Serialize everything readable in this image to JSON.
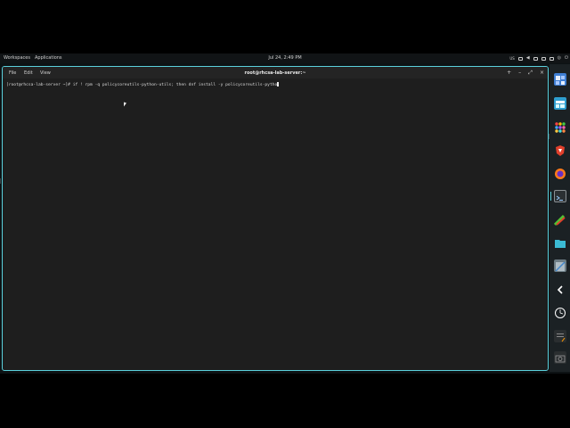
{
  "topbar": {
    "workspaces_label": "Workspaces",
    "applications_label": "Applications",
    "clock": "Jul 24, 2:49 PM",
    "keyboard_layout": "US"
  },
  "window": {
    "menu": {
      "file": "File",
      "edit": "Edit",
      "view": "View"
    },
    "title": "root@rhcsa-lab-server:~",
    "controls": {
      "add": "+",
      "minimize": "–",
      "maximize": "⤢",
      "close": "×"
    }
  },
  "terminal": {
    "prompt": "[root@rhcsa-lab-server ~]# ",
    "command": "if ! rpm -q policycoreutils-python-utils; then dnf install -y policycoreutils-pytho"
  },
  "dock": {
    "icons": [
      "app-grid-icon",
      "files-icon",
      "apps-icon",
      "brave-browser-icon",
      "firefox-icon",
      "terminal-icon",
      "paint-icon",
      "folder-icon",
      "image-viewer-icon",
      "chevron-left-icon",
      "timer-icon",
      "notes-icon",
      "screenshot-icon"
    ],
    "colors": {
      "accent": "#5ad0dc",
      "brave": "#e0402c",
      "firefox": "#ff7a1a",
      "folder": "#3bbbd4",
      "paint": "#52c234"
    }
  }
}
